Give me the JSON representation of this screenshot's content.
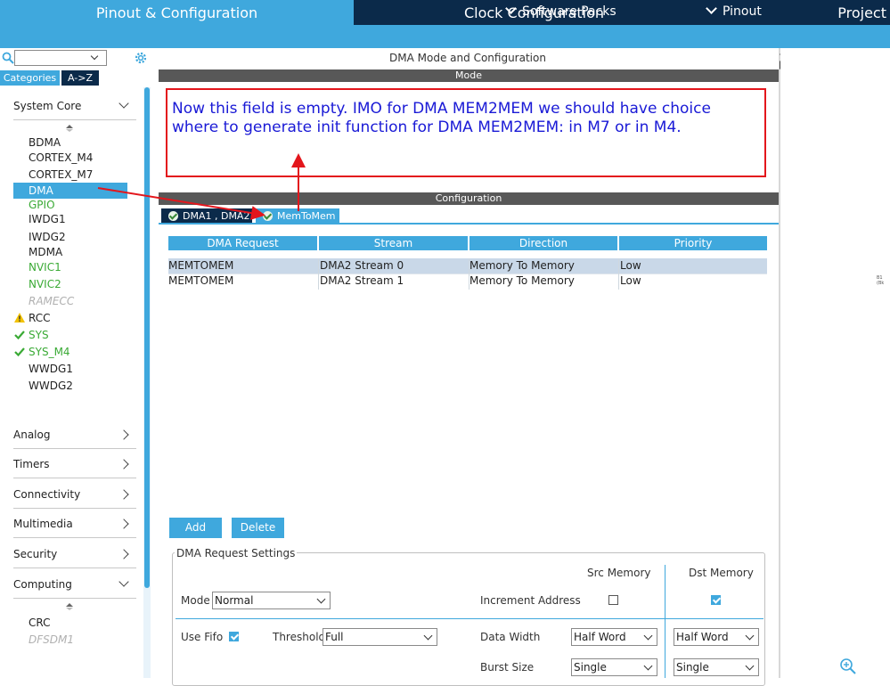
{
  "top_tabs": [
    "Pinout & Configuration",
    "Clock Configuration",
    "Project"
  ],
  "sub_menu": {
    "software_packs": "Software Packs",
    "pinout": "Pinout"
  },
  "left": {
    "categories_btn": "Categories",
    "az_btn": "A->Z",
    "system_core": "System Core",
    "peripherals": [
      {
        "label": "BDMA",
        "state": "normal"
      },
      {
        "label": "CORTEX_M4",
        "state": "normal"
      },
      {
        "label": "CORTEX_M7",
        "state": "normal"
      },
      {
        "label": "DMA",
        "state": "selected"
      },
      {
        "label": "GPIO",
        "state": "green"
      },
      {
        "label": "IWDG1",
        "state": "normal"
      },
      {
        "label": "IWDG2",
        "state": "normal"
      },
      {
        "label": "MDMA",
        "state": "normal"
      },
      {
        "label": "NVIC1",
        "state": "green"
      },
      {
        "label": "NVIC2",
        "state": "green"
      },
      {
        "label": "RAMECC",
        "state": "gray"
      },
      {
        "label": "RCC",
        "state": "warn"
      },
      {
        "label": "SYS",
        "state": "check"
      },
      {
        "label": "SYS_M4",
        "state": "check"
      },
      {
        "label": "WWDG1",
        "state": "normal"
      },
      {
        "label": "WWDG2",
        "state": "normal"
      }
    ],
    "categories": [
      "Analog",
      "Timers",
      "Connectivity",
      "Multimedia",
      "Security",
      "Computing"
    ],
    "computing_items": [
      {
        "label": "CRC",
        "state": "normal"
      },
      {
        "label": "DFSDM1",
        "state": "gray"
      }
    ]
  },
  "center": {
    "title": "DMA Mode and Configuration",
    "mode_bar": "Mode",
    "annotation": "Now this field is empty. IMO for DMA MEM2MEM we should have choice where to generate init function for DMA MEM2MEM: in M7 or in M4.",
    "config_bar": "Configuration",
    "subtabs": [
      "DMA1 , DMA2",
      "MemToMem"
    ],
    "table": {
      "headers": [
        "DMA Request",
        "Stream",
        "Direction",
        "Priority"
      ],
      "rows": [
        [
          "MEMTOMEM",
          "DMA2 Stream 0",
          "Memory To Memory",
          "Low"
        ],
        [
          "MEMTOMEM",
          "DMA2 Stream 1",
          "Memory To Memory",
          "Low"
        ]
      ]
    },
    "add_btn": "Add",
    "delete_btn": "Delete",
    "settings": {
      "legend": "DMA Request Settings",
      "src_memory": "Src Memory",
      "dst_memory": "Dst Memory",
      "mode_label": "Mode",
      "mode_value": "Normal",
      "increment_label": "Increment Address",
      "use_fifo_label": "Use Fifo",
      "threshold_label": "Threshold",
      "threshold_value": "Full",
      "data_width_label": "Data Width",
      "src_width": "Half Word",
      "dst_width": "Half Word",
      "burst_label": "Burst Size",
      "src_burst": "Single",
      "dst_burst": "Single"
    }
  },
  "right": {
    "tiny_label": "B1 (Bk"
  },
  "colors": {
    "accent": "#3fa8dd",
    "navy": "#0b2a4a",
    "annotation_red": "#e3161c",
    "annotation_blue": "#1a1ad6",
    "green": "#3aaa35"
  }
}
